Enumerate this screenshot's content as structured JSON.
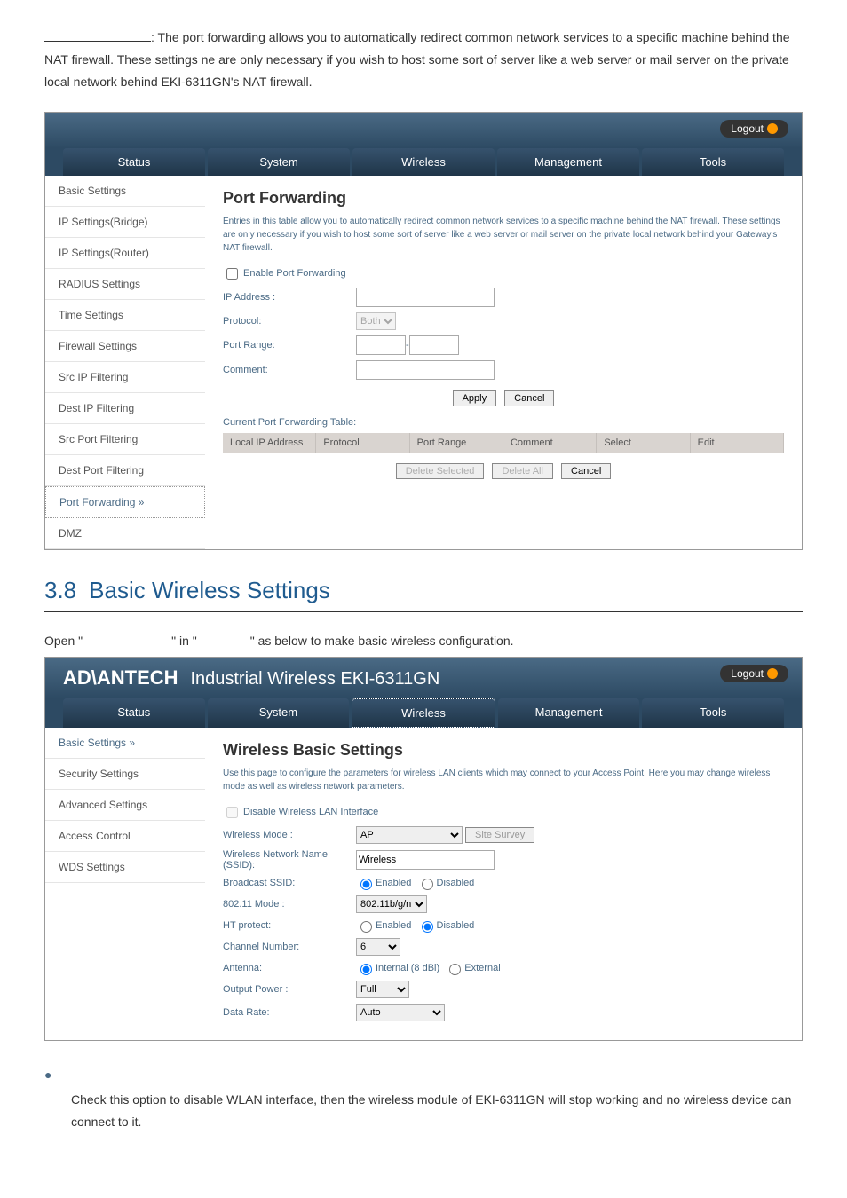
{
  "intro": {
    "text1": ": The port forwarding allows you to automatically redirect common network services to a specific machine behind the NAT firewall. These settings ne are only necessary if you wish to host some sort of server like a web server or mail server on the private local network behind EKI-6311GN's NAT firewall."
  },
  "router1": {
    "logout": "Logout",
    "tabs": {
      "status": "Status",
      "system": "System",
      "wireless": "Wireless",
      "management": "Management",
      "tools": "Tools"
    },
    "sidebar": [
      "Basic Settings",
      "IP Settings(Bridge)",
      "IP Settings(Router)",
      "RADIUS Settings",
      "Time Settings",
      "Firewall Settings",
      "Src IP Filtering",
      "Dest IP Filtering",
      "Src Port Filtering",
      "Dest Port Filtering",
      "Port Forwarding  »",
      "DMZ"
    ],
    "title": "Port Forwarding",
    "desc": "Entries in this table allow you to automatically redirect common network services to a specific machine behind the NAT firewall. These settings are only necessary if you wish to host some sort of server like a web server or mail server on the private local network behind your Gateway's NAT firewall.",
    "enable_label": "Enable Port Forwarding",
    "ip_label": "IP Address :",
    "proto_label": "Protocol:",
    "proto_val": "Both",
    "range_label": "Port Range:",
    "comment_label": "Comment:",
    "apply": "Apply",
    "cancel": "Cancel",
    "cur_table": "Current Port Forwarding Table:",
    "cols": [
      "Local IP Address",
      "Protocol",
      "Port Range",
      "Comment",
      "Select",
      "Edit"
    ],
    "del_sel": "Delete Selected",
    "del_all": "Delete All",
    "cancel2": "Cancel"
  },
  "sec38": {
    "num": "3.8",
    "title": "Basic Wireless Settings",
    "open_line_1": "Open \"",
    "open_line_2": "\" in \"",
    "open_line_3": "\" as below to make basic wireless configuration."
  },
  "router2": {
    "brand": "AD\\ANTECH",
    "subtitle": "Industrial Wireless EKI-6311GN",
    "logout": "Logout",
    "tabs": {
      "status": "Status",
      "system": "System",
      "wireless": "Wireless",
      "management": "Management",
      "tools": "Tools"
    },
    "sidebar": [
      "Basic Settings  »",
      "Security Settings",
      "Advanced Settings",
      "Access Control",
      "WDS Settings"
    ],
    "title": "Wireless Basic Settings",
    "desc": "Use this page to configure the parameters for wireless LAN clients which may connect to your Access Point. Here you may change wireless mode as well as wireless network parameters.",
    "disable_label": "Disable Wireless LAN Interface",
    "mode_label": "Wireless Mode :",
    "mode_val": "AP",
    "survey": "Site Survey",
    "ssid_label": "Wireless Network Name (SSID):",
    "ssid_val": "Wireless",
    "bcast_label": "Broadcast SSID:",
    "enabled": "Enabled",
    "disabled": "Disabled",
    "mode11_label": "802.11 Mode :",
    "mode11_val": "802.11b/g/n",
    "ht_label": "HT protect:",
    "chan_label": "Channel Number:",
    "chan_val": "6",
    "ant_label": "Antenna:",
    "ant_int": "Internal (8 dBi)",
    "ant_ext": "External",
    "pow_label": "Output Power :",
    "pow_val": "Full",
    "rate_label": "Data Rate:",
    "rate_val": "Auto"
  },
  "closing": {
    "text": "Check this option to disable WLAN interface, then the wireless module of EKI-6311GN will stop working and no wireless device can connect to it."
  }
}
